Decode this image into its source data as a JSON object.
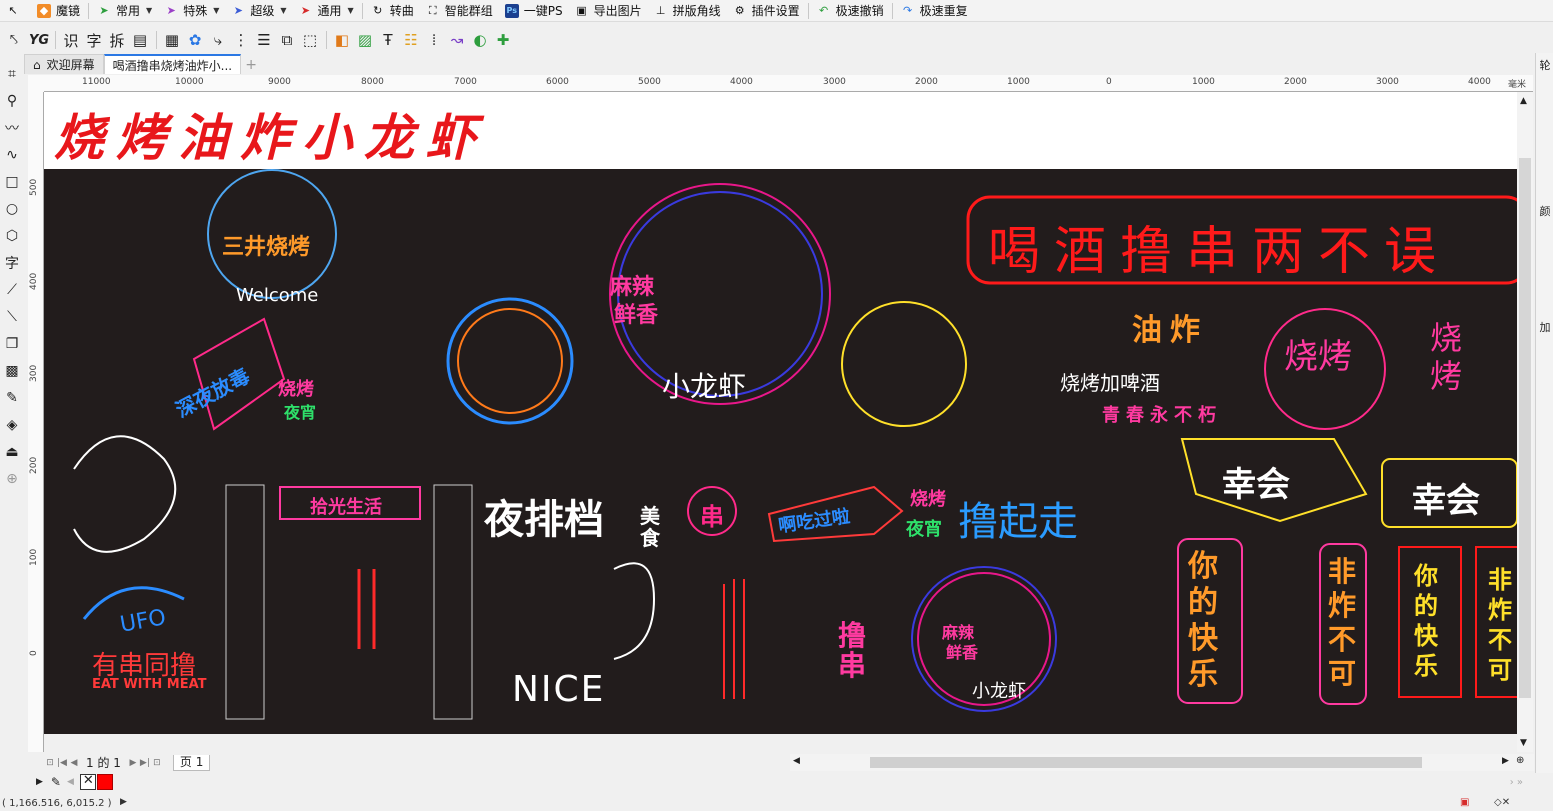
{
  "toolbar1": {
    "items": [
      {
        "label": "魔镜",
        "icon": "magic-mirror-icon",
        "color": "#f28c28",
        "caret": false
      },
      {
        "label": "常用",
        "icon": "common-tools-icon",
        "color": "#2e9e3e",
        "caret": true
      },
      {
        "label": "特殊",
        "icon": "special-tools-icon",
        "color": "#9a3fc7",
        "caret": true
      },
      {
        "label": "超级",
        "icon": "super-tools-icon",
        "color": "#3a5bd6",
        "caret": true
      },
      {
        "label": "通用",
        "icon": "general-tools-icon",
        "color": "#d62b2b",
        "caret": true
      },
      {
        "label": "转曲",
        "icon": "convert-curve-icon",
        "color": "#333333",
        "caret": false
      },
      {
        "label": "智能群组",
        "icon": "smart-group-icon",
        "color": "#333333",
        "caret": false
      },
      {
        "label": "一键PS",
        "icon": "photoshop-icon",
        "color": "#1b3f8f",
        "caret": false
      },
      {
        "label": "导出图片",
        "icon": "export-image-icon",
        "color": "#333333",
        "caret": false
      },
      {
        "label": "拼版角线",
        "icon": "crop-marks-icon",
        "color": "#333333",
        "caret": false
      },
      {
        "label": "插件设置",
        "icon": "gear-icon",
        "color": "#333333",
        "caret": false
      },
      {
        "label": "极速撤销",
        "icon": "undo-icon",
        "color": "#2e9e3e",
        "caret": false
      },
      {
        "label": "极速重复",
        "icon": "redo-icon",
        "color": "#2b78e4",
        "caret": false
      }
    ]
  },
  "toolbar2": {
    "labels": [
      "YG",
      "识",
      "字",
      "拆"
    ]
  },
  "tabs": {
    "welcome": "欢迎屏幕",
    "document": "喝酒撸串烧烤油炸小..."
  },
  "ruler": {
    "h_labels": [
      "11000",
      "10000",
      "9000",
      "8000",
      "7000",
      "6000",
      "5000",
      "4000",
      "3000",
      "2000",
      "1000",
      "0",
      "1000",
      "2000",
      "3000",
      "4000",
      "毫米"
    ],
    "v_labels": [
      "500",
      "400",
      "300",
      "200",
      "100",
      "0"
    ]
  },
  "canvas": {
    "title": "烧烤油炸小龙虾",
    "title_color": "#e8171b",
    "art_bg": "#221c1c",
    "neon_texts": {
      "sanjing": "三井烧烤",
      "welcome": "Welcome",
      "shenye": "深夜放毒",
      "shaokao_yexiao": "烧烤",
      "yexiao": "夜宵",
      "mala": "麻辣",
      "xianxiang": "鲜香",
      "xiaolongxia": "小龙虾",
      "hejiu": "喝酒撸串两不误",
      "youzha": "油炸",
      "shaokao_pijiu": "烧烤加啤酒",
      "qingchun": "青春永不朽",
      "shaokao2": "烧烤",
      "shaokao3": "烧烤",
      "shiguang": "拾光生活",
      "yepaidang": "夜排档",
      "meishi": "美食",
      "chuan": "串",
      "achiguo": "啊吃过啦",
      "shaokao4": "烧烤",
      "yexiao2": "夜宵",
      "luqizou": "撸起走",
      "xinghui": "幸会",
      "xinghui2": "幸会",
      "nidekuaile": "你的快乐",
      "feizhabuke": "非炸不可",
      "nidekuaile2": "你的快乐",
      "feizha2": "非炸不可",
      "ufo": "UFO",
      "youchuan": "有串同撸",
      "eatwithmeat": "EAT WITH MEAT",
      "nice": "NICE",
      "luchuan": "撸串",
      "mala2": "麻辣",
      "xianxiang2": "鲜香",
      "xiaolongxia2": "小龙虾"
    }
  },
  "pagenav": {
    "page_info": "1 的 1",
    "page_tab": "页 1"
  },
  "palette": {
    "swatches": [
      "#ffffff",
      "#ff0000"
    ]
  },
  "status": {
    "coords": "( 1,166.516, 6,015.2 )"
  },
  "docker": {
    "tabs": [
      "轮",
      "颜",
      "加"
    ]
  }
}
